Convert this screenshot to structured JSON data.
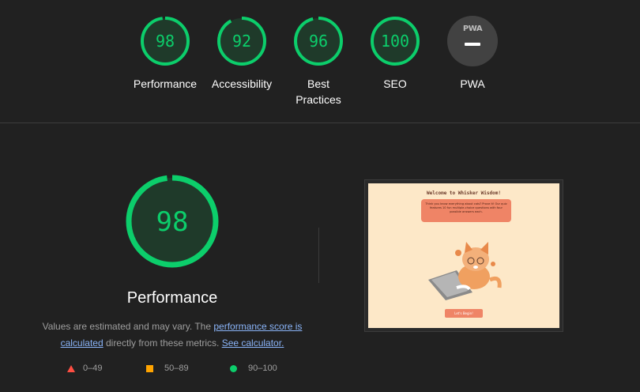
{
  "top_gauges": [
    {
      "score": "98",
      "label": "Performance",
      "value": 98
    },
    {
      "score": "92",
      "label": "Accessibility",
      "value": 92
    },
    {
      "score": "96",
      "label": "Best Practices",
      "value": 96
    },
    {
      "score": "100",
      "label": "SEO",
      "value": 100
    }
  ],
  "pwa": {
    "badge": "PWA",
    "label": "PWA"
  },
  "main": {
    "score": "98",
    "value": 98,
    "title": "Performance",
    "desc_prefix": "Values are estimated and may vary. The ",
    "link_score": "performance score is calculated",
    "desc_middle": " directly from these metrics. ",
    "link_calc": "See calculator."
  },
  "legend": {
    "fail": "0–49",
    "average": "50–89",
    "pass": "90–100"
  },
  "screenshot": {
    "title": "Welcome to Whisker Wisdom!",
    "intro": "Think you know everything about cats? Prove it! Our quiz features 10 fun multiple-choice questions with four possible answers each.",
    "button": "Let's Begin!"
  },
  "colors": {
    "pass": "#0cce6b",
    "pass_bg": "#1f3a2a",
    "average": "#ffa400",
    "fail": "#ff4e42",
    "link": "#8ab4f8"
  }
}
